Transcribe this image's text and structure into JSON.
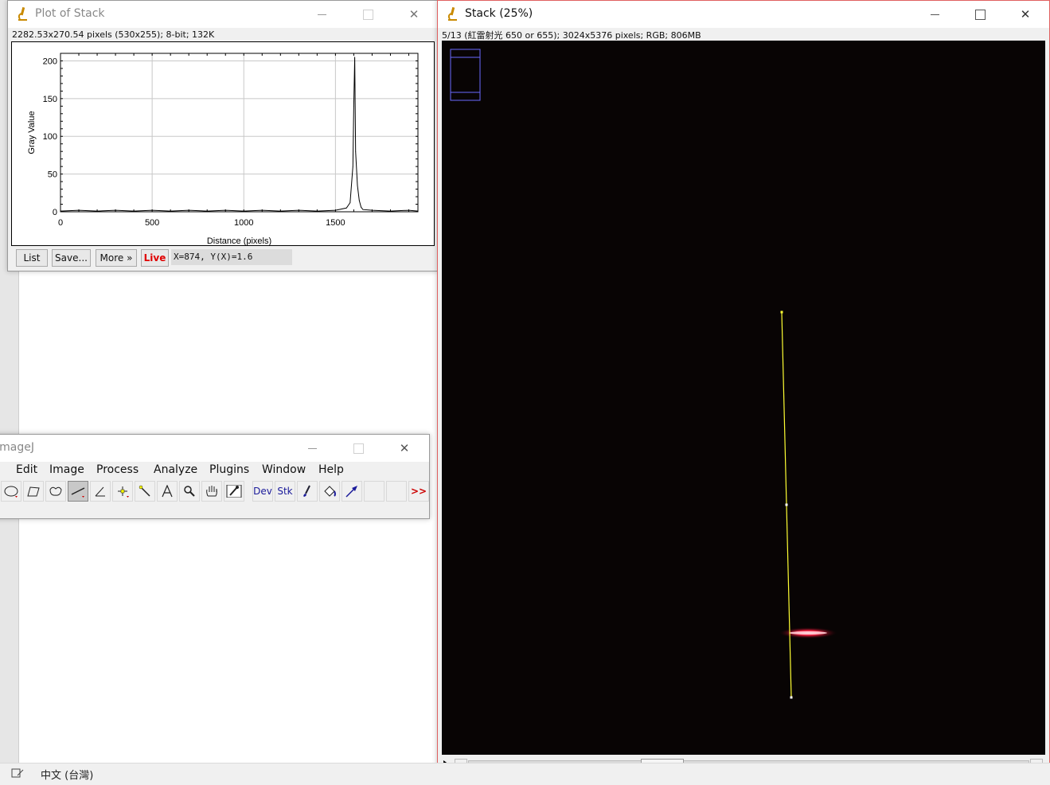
{
  "statusbar": {
    "language": "中文 (台灣)"
  },
  "plot_window": {
    "title": "Plot of Stack",
    "info": "2282.53x270.54 pixels (530x255); 8-bit; 132K",
    "buttons": {
      "list": "List",
      "save": "Save...",
      "more": "More »",
      "live": "Live"
    },
    "coordinate_readout": "X=874, Y(X)=1.6"
  },
  "chart_data": {
    "type": "line",
    "title": "",
    "xlabel": "Distance (pixels)",
    "ylabel": "Gray Value",
    "xlim": [
      0,
      1950
    ],
    "ylim": [
      0,
      210
    ],
    "x_ticks": [
      0,
      500,
      1000,
      1500
    ],
    "y_ticks": [
      0,
      50,
      100,
      150,
      200
    ],
    "grid": true,
    "x": [
      0,
      100,
      200,
      300,
      400,
      500,
      600,
      700,
      800,
      900,
      1000,
      1100,
      1200,
      1300,
      1400,
      1500,
      1560,
      1580,
      1595,
      1600,
      1605,
      1610,
      1620,
      1630,
      1640,
      1650,
      1700,
      1800,
      1900,
      1950
    ],
    "y": [
      1,
      2,
      1,
      2,
      1,
      2,
      1,
      2,
      1,
      2,
      1,
      2,
      1,
      2,
      1,
      2,
      5,
      12,
      60,
      140,
      205,
      80,
      35,
      15,
      6,
      3,
      2,
      1,
      2,
      1
    ]
  },
  "stack_window": {
    "title": "Stack (25%)",
    "info": "5/13 (紅雷射光 650 or 655); 3024x5376 pixels; RGB; 806MB"
  },
  "imagej_window": {
    "title": "ImageJ",
    "menus": [
      "Edit",
      "Image",
      "Process",
      "Analyze",
      "Plugins",
      "Window",
      "Help"
    ],
    "tools": {
      "dev": "Dev",
      "stk": "Stk",
      "more": ">>"
    }
  },
  "colors": {
    "line_selection": "#ffff33",
    "laser_red": "#ff2244",
    "image_bg": "#080404"
  }
}
